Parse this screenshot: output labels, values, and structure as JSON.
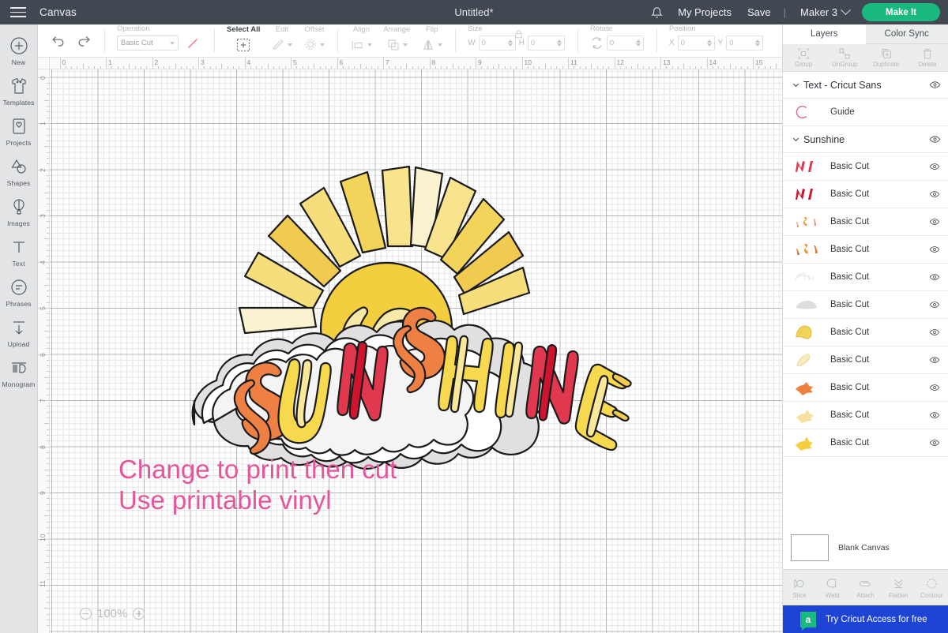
{
  "topbar": {
    "menu_icon": "hamburger-icon",
    "canvas_label": "Canvas",
    "project_title": "Untitled*",
    "bell_icon": "bell-icon",
    "my_projects": "My Projects",
    "save": "Save",
    "separator": "|",
    "machine": "Maker 3",
    "make_it": "Make It",
    "accent_green": "#19b97f",
    "bar_color": "#424852"
  },
  "rail": {
    "items": [
      {
        "label": "New",
        "icon": "plus-circle-icon"
      },
      {
        "label": "Templates",
        "icon": "tshirt-icon"
      },
      {
        "label": "Projects",
        "icon": "project-card-icon"
      },
      {
        "label": "Shapes",
        "icon": "shapes-icon"
      },
      {
        "label": "Images",
        "icon": "hot-air-balloon-icon"
      },
      {
        "label": "Text",
        "icon": "text-t-icon"
      },
      {
        "label": "Phrases",
        "icon": "speech-bubble-icon"
      },
      {
        "label": "Upload",
        "icon": "upload-arrow-icon"
      },
      {
        "label": "Monogram",
        "icon": "monogram-icon"
      }
    ]
  },
  "toolbar": {
    "undo": "undo-icon",
    "redo": "redo-icon",
    "operation_label": "Operation",
    "operation_value": "Basic Cut",
    "color_swatch_icon": "pen-swatch-icon",
    "select_all": "Select All",
    "edit": "Edit",
    "offset": "Offset",
    "align": "Align",
    "arrange": "Arrange",
    "flip": "Flip",
    "size_label": "Size",
    "lock_icon": "lock-icon",
    "width_label": "W",
    "width_value": "0",
    "height_label": "H",
    "height_value": "0",
    "rotate_label": "Rotate",
    "rotate_value": "0",
    "position_label": "Position",
    "x_label": "X",
    "x_value": "0",
    "y_label": "Y",
    "y_value": "0"
  },
  "canvas": {
    "zoom_level": "100%",
    "zoom_out_icon": "minus-circle-icon",
    "zoom_in_icon": "plus-circle-icon",
    "ruler_h_labels": [
      "0",
      "1",
      "2",
      "3",
      "4",
      "5",
      "6",
      "7",
      "8",
      "9",
      "10",
      "11",
      "12",
      "13",
      "14",
      "15"
    ],
    "ruler_v_labels": [
      "0",
      "1",
      "2",
      "3",
      "4",
      "5",
      "6",
      "7",
      "8",
      "9",
      "10",
      "11"
    ],
    "memo_lines": [
      "Change to print then cut",
      "Use printable vinyl"
    ],
    "memo_color": "#e5559a",
    "artwork_title": "Sunshine"
  },
  "right_panel": {
    "tabs": [
      {
        "label": "Layers",
        "active": true
      },
      {
        "label": "Color Sync",
        "active": false
      }
    ],
    "tools": [
      {
        "label": "Group",
        "icon": "group-icon"
      },
      {
        "label": "UnGroup",
        "icon": "ungroup-icon"
      },
      {
        "label": "Duplicate",
        "icon": "duplicate-icon"
      },
      {
        "label": "Delete",
        "icon": "trash-icon"
      }
    ],
    "groups": [
      {
        "name": "Text - Cricut Sans",
        "eye_icon": "eye-icon",
        "twist_icon": "chevron-down-icon",
        "layers": [
          {
            "name": "Guide",
            "thumb": "pink-letter-c",
            "colors": [
              "#d4628f"
            ],
            "eye": false
          }
        ]
      },
      {
        "name": "Sunshine",
        "eye_icon": "eye-icon",
        "twist_icon": "chevron-down-icon",
        "layers": [
          {
            "name": "Basic Cut",
            "thumb": "letter-strokes",
            "colors": [
              "#e03a52",
              "#e03a52"
            ],
            "eye": true
          },
          {
            "name": "Basic Cut",
            "thumb": "letter-strokes",
            "colors": [
              "#d8142e",
              "#d8142e"
            ],
            "eye": true
          },
          {
            "name": "Basic Cut",
            "thumb": "small-marks",
            "colors": [
              "#e8a070",
              "#f0a040",
              "#e89060"
            ],
            "eye": true
          },
          {
            "name": "Basic Cut",
            "thumb": "small-marks",
            "colors": [
              "#e08040",
              "#f09030",
              "#e08040"
            ],
            "eye": true
          },
          {
            "name": "Basic Cut",
            "thumb": "faint-outline",
            "colors": [
              "#ededed"
            ],
            "eye": true
          },
          {
            "name": "Basic Cut",
            "thumb": "grey-blob",
            "colors": [
              "#dddddd"
            ],
            "eye": true
          },
          {
            "name": "Basic Cut",
            "thumb": "yellow-arc",
            "colors": [
              "#f2d45a"
            ],
            "eye": true
          },
          {
            "name": "Basic Cut",
            "thumb": "pale-arc",
            "colors": [
              "#f7ecc0"
            ],
            "eye": true
          },
          {
            "name": "Basic Cut",
            "thumb": "orange-burst",
            "colors": [
              "#ef8040"
            ],
            "eye": true
          },
          {
            "name": "Basic Cut",
            "thumb": "pale-burst",
            "colors": [
              "#f6e2a0"
            ],
            "eye": true
          },
          {
            "name": "Basic Cut",
            "thumb": "yellow-burst",
            "colors": [
              "#f3cf3f"
            ],
            "eye": true
          }
        ]
      }
    ],
    "canvas_swatch_label": "Blank Canvas",
    "ops": [
      {
        "label": "Slice",
        "icon": "slice-icon"
      },
      {
        "label": "Weld",
        "icon": "weld-icon"
      },
      {
        "label": "Attach",
        "icon": "attach-icon"
      },
      {
        "label": "Flatten",
        "icon": "flatten-icon"
      },
      {
        "label": "Contour",
        "icon": "contour-icon"
      }
    ],
    "promo": {
      "text": "Try Cricut Access for free",
      "badge": "a",
      "bg": "#1e44d6"
    }
  },
  "artwork_palette": {
    "outline": "#1a1a1a",
    "sticker_white": "#ffffff",
    "sticker_grey": "#e0e0e0",
    "red": "#e0384f",
    "deep_red": "#cf1430",
    "orange": "#ef8044",
    "yellow": "#f7d94f",
    "pale_yellow": "#f9e79a",
    "cream": "#fbf3cf",
    "gold": "#f0cb50"
  }
}
